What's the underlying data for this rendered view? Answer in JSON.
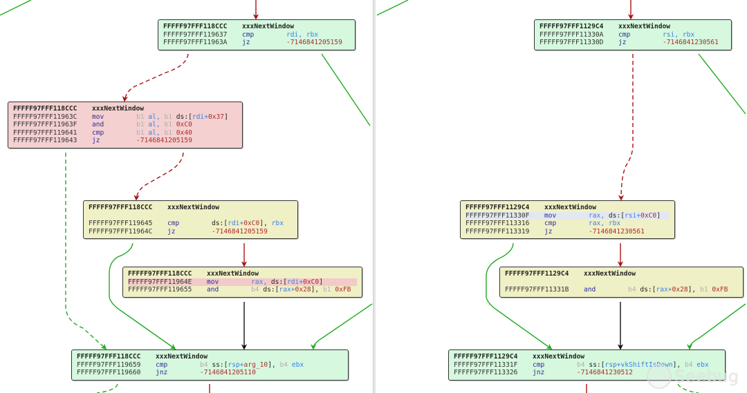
{
  "colors": {
    "block_green": "#d5f8de",
    "block_red": "#f4d0d0",
    "block_yellow": "#f0f0c6",
    "edge_true": "#22aa22",
    "edge_false": "#aa1111",
    "edge_uncond": "#111111",
    "mnemonic": "#2b2b9c",
    "register": "#3b7fe3",
    "number": "#b12a2a"
  },
  "logo": {
    "text": "Seebug",
    "icon": "seebug-logo-icon"
  },
  "left_graph": {
    "blocks": [
      {
        "id": "L1",
        "color": "green",
        "addr": "FFFFF97FFF118CCC",
        "func": "xxxNextWindow",
        "gap": false,
        "lines": [
          {
            "addr": "FFFFF97FFF119637",
            "mnem": "cmp",
            "ops": [
              {
                "k": "r",
                "v": "rdi, rbx"
              }
            ]
          },
          {
            "addr": "FFFFF97FFF11963A",
            "mnem": "jz",
            "ops": [
              {
                "k": "n",
                "v": "-7146841205159"
              }
            ]
          }
        ]
      },
      {
        "id": "L2",
        "color": "red",
        "addr": "FFFFF97FFF118CCC",
        "func": "xxxNextWindow",
        "gap": false,
        "lines": [
          {
            "addr": "FFFFF97FFF11963C",
            "mnem": "mov",
            "ops": [
              {
                "k": "p",
                "v": "b1 "
              },
              {
                "k": "r",
                "v": "al, "
              },
              {
                "k": "p",
                "v": "b1 "
              },
              {
                "k": "t",
                "v": "ds:["
              },
              {
                "k": "r",
                "v": "rdi+"
              },
              {
                "k": "n",
                "v": "0x37"
              },
              {
                "k": "t",
                "v": "]"
              }
            ]
          },
          {
            "addr": "FFFFF97FFF11963F",
            "mnem": "and",
            "ops": [
              {
                "k": "p",
                "v": "b1 "
              },
              {
                "k": "r",
                "v": "al, "
              },
              {
                "k": "p",
                "v": "b1 "
              },
              {
                "k": "n",
                "v": "0xC0"
              }
            ]
          },
          {
            "addr": "FFFFF97FFF119641",
            "mnem": "cmp",
            "ops": [
              {
                "k": "p",
                "v": "b1 "
              },
              {
                "k": "r",
                "v": "al, "
              },
              {
                "k": "p",
                "v": "b1 "
              },
              {
                "k": "n",
                "v": "0x40"
              }
            ]
          },
          {
            "addr": "FFFFF97FFF119643",
            "mnem": "jz",
            "ops": [
              {
                "k": "n",
                "v": "-7146841205159"
              }
            ]
          }
        ]
      },
      {
        "id": "L3",
        "color": "yellow",
        "addr": "FFFFF97FFF118CCC",
        "func": "xxxNextWindow",
        "gap": true,
        "lines": [
          {
            "addr": "FFFFF97FFF119645",
            "mnem": "cmp",
            "ops": [
              {
                "k": "t",
                "v": "ds:["
              },
              {
                "k": "r",
                "v": "rdi+"
              },
              {
                "k": "n",
                "v": "0xC0"
              },
              {
                "k": "t",
                "v": "], "
              },
              {
                "k": "r",
                "v": "rbx"
              }
            ]
          },
          {
            "addr": "FFFFF97FFF11964C",
            "mnem": "jz",
            "ops": [
              {
                "k": "n",
                "v": "-7146841205159"
              }
            ]
          }
        ]
      },
      {
        "id": "L4",
        "color": "yellow",
        "addr": "FFFFF97FFF118CCC",
        "func": "xxxNextWindow",
        "gap": false,
        "lines": [
          {
            "addr": "FFFFF97FFF11964E",
            "mnem": "mov",
            "highlight": "pink",
            "ops": [
              {
                "k": "r",
                "v": "rax, "
              },
              {
                "k": "t",
                "v": "ds:["
              },
              {
                "k": "r",
                "v": "rdi+"
              },
              {
                "k": "n",
                "v": "0xC0"
              },
              {
                "k": "t",
                "v": "]"
              }
            ]
          },
          {
            "addr": "FFFFF97FFF119655",
            "mnem": "and",
            "ops": [
              {
                "k": "p",
                "v": "b4 "
              },
              {
                "k": "t",
                "v": "ds:["
              },
              {
                "k": "r",
                "v": "rax+"
              },
              {
                "k": "n",
                "v": "0x28"
              },
              {
                "k": "t",
                "v": "], "
              },
              {
                "k": "p",
                "v": "b1 "
              },
              {
                "k": "n",
                "v": "0xFB"
              }
            ]
          }
        ]
      },
      {
        "id": "L5",
        "color": "green",
        "addr": "FFFFF97FFF118CCC",
        "func": "xxxNextWindow",
        "gap": false,
        "lines": [
          {
            "addr": "FFFFF97FFF119659",
            "mnem": "cmp",
            "ops": [
              {
                "k": "p",
                "v": "b4 "
              },
              {
                "k": "t",
                "v": "ss:["
              },
              {
                "k": "r",
                "v": "rsp+"
              },
              {
                "k": "n",
                "v": "arg_10"
              },
              {
                "k": "t",
                "v": "], "
              },
              {
                "k": "p",
                "v": "b4 "
              },
              {
                "k": "r",
                "v": "ebx"
              }
            ]
          },
          {
            "addr": "FFFFF97FFF119660",
            "mnem": "jnz",
            "ops": [
              {
                "k": "n",
                "v": "-7146841205110"
              }
            ]
          }
        ]
      }
    ]
  },
  "right_graph": {
    "blocks": [
      {
        "id": "R1",
        "color": "green",
        "addr": "FFFFF97FFF1129C4",
        "func": "xxxNextWindow",
        "gap": false,
        "lines": [
          {
            "addr": "FFFFF97FFF11330A",
            "mnem": "cmp",
            "ops": [
              {
                "k": "r",
                "v": "rsi, rbx"
              }
            ]
          },
          {
            "addr": "FFFFF97FFF11330D",
            "mnem": "jz",
            "ops": [
              {
                "k": "n",
                "v": "-7146841230561"
              }
            ]
          }
        ]
      },
      {
        "id": "R2",
        "color": "yellow",
        "addr": "FFFFF97FFF1129C4",
        "func": "xxxNextWindow",
        "gap": false,
        "lines": [
          {
            "addr": "FFFFF97FFF11330F",
            "mnem": "mov",
            "highlight": "gray",
            "ops": [
              {
                "k": "r",
                "v": "rax, "
              },
              {
                "k": "t",
                "v": "ds:["
              },
              {
                "k": "r",
                "v": "rsi+"
              },
              {
                "k": "n",
                "v": "0xC0"
              },
              {
                "k": "t",
                "v": "]"
              }
            ]
          },
          {
            "addr": "FFFFF97FFF113316",
            "mnem": "cmp",
            "ops": [
              {
                "k": "r",
                "v": "rax, rbx"
              }
            ]
          },
          {
            "addr": "FFFFF97FFF113319",
            "mnem": "jz",
            "ops": [
              {
                "k": "n",
                "v": "-7146841230561"
              }
            ]
          }
        ]
      },
      {
        "id": "R3",
        "color": "yellow",
        "addr": "FFFFF97FFF1129C4",
        "func": "xxxNextWindow",
        "gap": true,
        "lines": [
          {
            "addr": "FFFFF97FFF11331B",
            "mnem": "and",
            "ops": [
              {
                "k": "p",
                "v": "b4 "
              },
              {
                "k": "t",
                "v": "ds:["
              },
              {
                "k": "r",
                "v": "rax+"
              },
              {
                "k": "n",
                "v": "0x28"
              },
              {
                "k": "t",
                "v": "], "
              },
              {
                "k": "p",
                "v": "b1 "
              },
              {
                "k": "n",
                "v": "0xFB"
              }
            ]
          }
        ]
      },
      {
        "id": "R4",
        "color": "green",
        "addr": "FFFFF97FFF1129C4",
        "func": "xxxNextWindow",
        "gap": false,
        "lines": [
          {
            "addr": "FFFFF97FFF11331F",
            "mnem": "cmp",
            "ops": [
              {
                "k": "p",
                "v": "b4 "
              },
              {
                "k": "t",
                "v": "ss:["
              },
              {
                "k": "r",
                "v": "rsp+"
              },
              {
                "k": "r",
                "v": "vkShiftIsDown"
              },
              {
                "k": "t",
                "v": "], "
              },
              {
                "k": "p",
                "v": "b4 "
              },
              {
                "k": "r",
                "v": "ebx"
              }
            ]
          },
          {
            "addr": "FFFFF97FFF113326",
            "mnem": "jnz",
            "ops": [
              {
                "k": "n",
                "v": "-7146841230512"
              }
            ]
          }
        ]
      }
    ]
  }
}
